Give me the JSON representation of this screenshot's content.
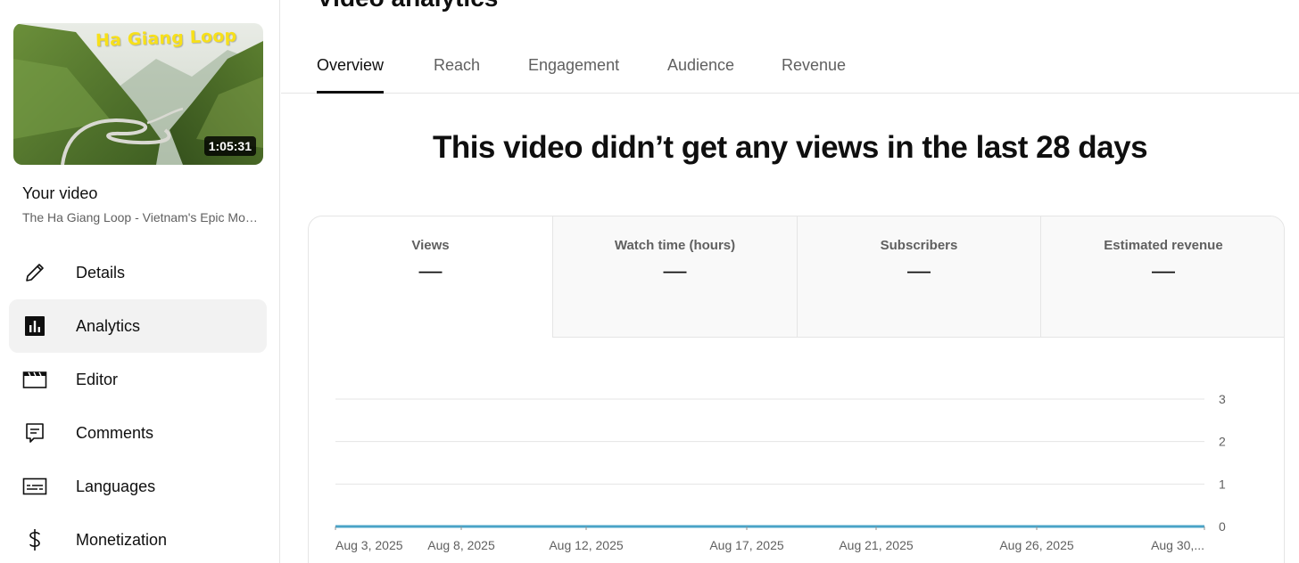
{
  "sidebar": {
    "thumbnail": {
      "title_overlay": "Ha Giang Loop",
      "duration": "1:05:31"
    },
    "your_video_label": "Your video",
    "video_title": "The Ha Giang Loop - Vietnam's Epic Motorbike Adventure",
    "items": [
      {
        "label": "Details",
        "icon": "pencil-icon",
        "active": false
      },
      {
        "label": "Analytics",
        "icon": "analytics-icon",
        "active": true
      },
      {
        "label": "Editor",
        "icon": "clapperboard-icon",
        "active": false
      },
      {
        "label": "Comments",
        "icon": "comment-icon",
        "active": false
      },
      {
        "label": "Languages",
        "icon": "subtitles-icon",
        "active": false
      },
      {
        "label": "Monetization",
        "icon": "dollar-icon",
        "active": false
      }
    ]
  },
  "main": {
    "page_title": "Video analytics",
    "tabs": [
      "Overview",
      "Reach",
      "Engagement",
      "Audience",
      "Revenue"
    ],
    "active_tab": "Overview",
    "headline": "This video didn’t get any views in the last 28 days",
    "metrics": [
      {
        "label": "Views",
        "value": "—"
      },
      {
        "label": "Watch time (hours)",
        "value": "—"
      },
      {
        "label": "Subscribers",
        "value": "—"
      },
      {
        "label": "Estimated revenue",
        "value": "—"
      }
    ]
  },
  "chart_data": {
    "type": "line",
    "x_ticks": [
      "Aug 3, 2025",
      "Aug 8, 2025",
      "Aug 12, 2025",
      "Aug 17, 2025",
      "Aug 21, 2025",
      "Aug 26, 2025",
      "Aug 30,..."
    ],
    "y_ticks": [
      0,
      1,
      2,
      3
    ],
    "ylim": [
      0,
      3
    ],
    "series": [
      {
        "values": [
          0,
          0,
          0,
          0,
          0,
          0,
          0
        ]
      }
    ],
    "grid": true,
    "line_color": "#4aa3c7"
  },
  "colors": {
    "accent_line": "#4aa3c7",
    "thumb_title": "#f7e01a"
  }
}
